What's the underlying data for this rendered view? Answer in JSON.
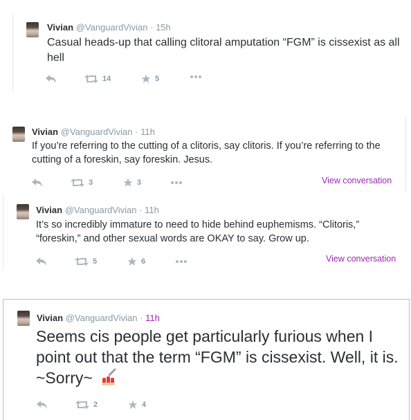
{
  "tweets": [
    {
      "name": "Vivian",
      "handle": "@VanguardVivian",
      "time": "15h",
      "text": "Casual heads-up that calling clitoral amputation “FGM” is cissexist as all hell",
      "retweets": "14",
      "likes": "5"
    },
    {
      "name": "Vivian",
      "handle": "@VanguardVivian",
      "time": "11h",
      "text": "If you’re referring to the cutting of a clitoris, say clitoris. If you’re referring to the cutting of a foreskin, say foreskin. Jesus.",
      "retweets": "3",
      "likes": "3",
      "view_conversation": "View conversation"
    },
    {
      "name": "Vivian",
      "handle": "@VanguardVivian",
      "time": "11h",
      "text": "It’s so incredibly immature to need to hide behind euphemisms. “Clitoris,” “foreskin,” and other sexual words are OKAY to say. Grow up.",
      "retweets": "5",
      "likes": "6",
      "view_conversation": "View conversation"
    },
    {
      "name": "Vivian",
      "handle": "@VanguardVivian",
      "time": "11h",
      "text": "Seems cis people get particularly furious when I point out that the term “FGM” is cissexist. Well, it is. ~Sorry~",
      "retweets": "2",
      "likes": "4"
    }
  ],
  "dot_separator": "·",
  "colors": {
    "link": "#9c27b0",
    "muted": "#8899a6",
    "icon": "#aab8c2",
    "highlight_border": "#d8a8d8"
  }
}
